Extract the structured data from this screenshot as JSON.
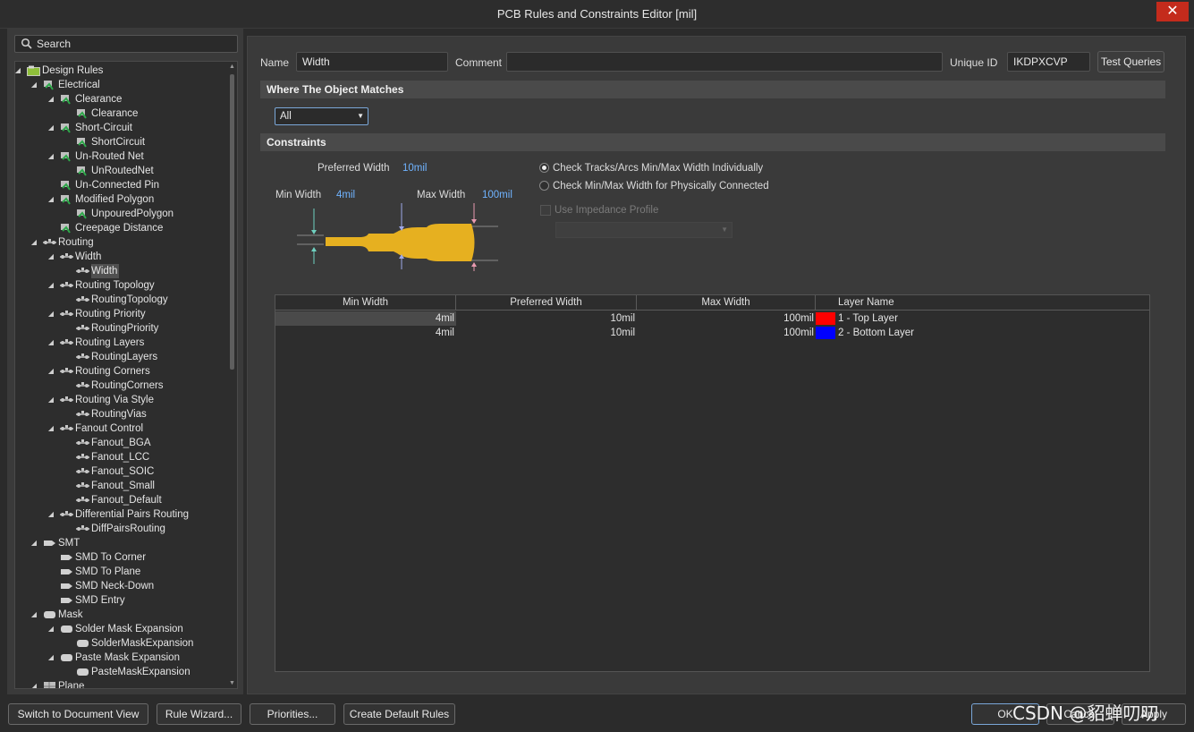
{
  "window": {
    "title": "PCB Rules and Constraints Editor [mil]",
    "close_glyph": "✕"
  },
  "search": {
    "placeholder": "Search",
    "value": ""
  },
  "tree": [
    {
      "label": "Design Rules",
      "depth": 0,
      "arrow": "◢",
      "icon": "design-rules-icon"
    },
    {
      "label": "Electrical",
      "depth": 1,
      "arrow": "◢",
      "icon": "rule-category-icon"
    },
    {
      "label": "Clearance",
      "depth": 2,
      "arrow": "◢",
      "icon": "rule-type-icon"
    },
    {
      "label": "Clearance",
      "depth": 3,
      "arrow": "",
      "icon": "rule-icon"
    },
    {
      "label": "Short-Circuit",
      "depth": 2,
      "arrow": "◢",
      "icon": "rule-type-icon"
    },
    {
      "label": "ShortCircuit",
      "depth": 3,
      "arrow": "",
      "icon": "rule-icon"
    },
    {
      "label": "Un-Routed Net",
      "depth": 2,
      "arrow": "◢",
      "icon": "rule-type-icon"
    },
    {
      "label": "UnRoutedNet",
      "depth": 3,
      "arrow": "",
      "icon": "rule-icon"
    },
    {
      "label": "Un-Connected Pin",
      "depth": 2,
      "arrow": "",
      "icon": "rule-type-icon"
    },
    {
      "label": "Modified Polygon",
      "depth": 2,
      "arrow": "◢",
      "icon": "rule-type-icon"
    },
    {
      "label": "UnpouredPolygon",
      "depth": 3,
      "arrow": "",
      "icon": "rule-icon"
    },
    {
      "label": "Creepage Distance",
      "depth": 2,
      "arrow": "",
      "icon": "rule-type-icon"
    },
    {
      "label": "Routing",
      "depth": 1,
      "arrow": "◢",
      "icon": "routing-icon"
    },
    {
      "label": "Width",
      "depth": 2,
      "arrow": "◢",
      "icon": "routing-icon"
    },
    {
      "label": "Width",
      "depth": 3,
      "arrow": "",
      "icon": "routing-icon",
      "selected": true
    },
    {
      "label": "Routing Topology",
      "depth": 2,
      "arrow": "◢",
      "icon": "routing-icon"
    },
    {
      "label": "RoutingTopology",
      "depth": 3,
      "arrow": "",
      "icon": "routing-icon"
    },
    {
      "label": "Routing Priority",
      "depth": 2,
      "arrow": "◢",
      "icon": "routing-icon"
    },
    {
      "label": "RoutingPriority",
      "depth": 3,
      "arrow": "",
      "icon": "routing-icon"
    },
    {
      "label": "Routing Layers",
      "depth": 2,
      "arrow": "◢",
      "icon": "routing-icon"
    },
    {
      "label": "RoutingLayers",
      "depth": 3,
      "arrow": "",
      "icon": "routing-icon"
    },
    {
      "label": "Routing Corners",
      "depth": 2,
      "arrow": "◢",
      "icon": "routing-icon"
    },
    {
      "label": "RoutingCorners",
      "depth": 3,
      "arrow": "",
      "icon": "routing-icon"
    },
    {
      "label": "Routing Via Style",
      "depth": 2,
      "arrow": "◢",
      "icon": "routing-icon"
    },
    {
      "label": "RoutingVias",
      "depth": 3,
      "arrow": "",
      "icon": "routing-icon"
    },
    {
      "label": "Fanout Control",
      "depth": 2,
      "arrow": "◢",
      "icon": "routing-icon"
    },
    {
      "label": "Fanout_BGA",
      "depth": 3,
      "arrow": "",
      "icon": "routing-icon"
    },
    {
      "label": "Fanout_LCC",
      "depth": 3,
      "arrow": "",
      "icon": "routing-icon"
    },
    {
      "label": "Fanout_SOIC",
      "depth": 3,
      "arrow": "",
      "icon": "routing-icon"
    },
    {
      "label": "Fanout_Small",
      "depth": 3,
      "arrow": "",
      "icon": "routing-icon"
    },
    {
      "label": "Fanout_Default",
      "depth": 3,
      "arrow": "",
      "icon": "routing-icon"
    },
    {
      "label": "Differential Pairs Routing",
      "depth": 2,
      "arrow": "◢",
      "icon": "routing-icon"
    },
    {
      "label": "DiffPairsRouting",
      "depth": 3,
      "arrow": "",
      "icon": "routing-icon"
    },
    {
      "label": "SMT",
      "depth": 1,
      "arrow": "◢",
      "icon": "smt-icon"
    },
    {
      "label": "SMD To Corner",
      "depth": 2,
      "arrow": "",
      "icon": "smt-icon"
    },
    {
      "label": "SMD To Plane",
      "depth": 2,
      "arrow": "",
      "icon": "smt-icon"
    },
    {
      "label": "SMD Neck-Down",
      "depth": 2,
      "arrow": "",
      "icon": "smt-icon"
    },
    {
      "label": "SMD Entry",
      "depth": 2,
      "arrow": "",
      "icon": "smt-icon"
    },
    {
      "label": "Mask",
      "depth": 1,
      "arrow": "◢",
      "icon": "mask-icon"
    },
    {
      "label": "Solder Mask Expansion",
      "depth": 2,
      "arrow": "◢",
      "icon": "mask-icon"
    },
    {
      "label": "SolderMaskExpansion",
      "depth": 3,
      "arrow": "",
      "icon": "mask-icon"
    },
    {
      "label": "Paste Mask Expansion",
      "depth": 2,
      "arrow": "◢",
      "icon": "mask-icon"
    },
    {
      "label": "PasteMaskExpansion",
      "depth": 3,
      "arrow": "",
      "icon": "mask-icon"
    },
    {
      "label": "Plane",
      "depth": 1,
      "arrow": "◢",
      "icon": "plane-icon"
    }
  ],
  "header": {
    "name_label": "Name",
    "name_value": "Width",
    "comment_label": "Comment",
    "comment_value": "",
    "uid_label": "Unique ID",
    "uid_value": "IKDPXCVP",
    "test_queries": "Test Queries"
  },
  "where": {
    "title": "Where The Object Matches",
    "scope": "All"
  },
  "constraints": {
    "title": "Constraints",
    "preferred_label": "Preferred Width",
    "preferred_value": "10mil",
    "min_label": "Min Width",
    "min_value": "4mil",
    "max_label": "Max Width",
    "max_value": "100mil",
    "radio1": "Check Tracks/Arcs Min/Max Width Individually",
    "radio2": "Check Min/Max Width for Physically Connected",
    "impedance": "Use Impedance Profile",
    "trace_color": "#e6b020"
  },
  "grid": {
    "columns": [
      "Min Width",
      "Preferred Width",
      "Max Width",
      "Layer Name"
    ],
    "rows": [
      {
        "min": "4mil",
        "pref": "10mil",
        "max": "100mil",
        "layer": "1 - Top Layer",
        "color": "#ff0000"
      },
      {
        "min": "4mil",
        "pref": "10mil",
        "max": "100mil",
        "layer": "2 - Bottom Layer",
        "color": "#0000ff"
      }
    ]
  },
  "footer": {
    "switch_view": "Switch to Document View",
    "rule_wizard": "Rule Wizard...",
    "priorities": "Priorities...",
    "create_default": "Create Default Rules",
    "ok": "OK",
    "cancel": "Cancel",
    "apply": "Apply",
    "watermark": "CSDN @貂蝉叨叨"
  }
}
